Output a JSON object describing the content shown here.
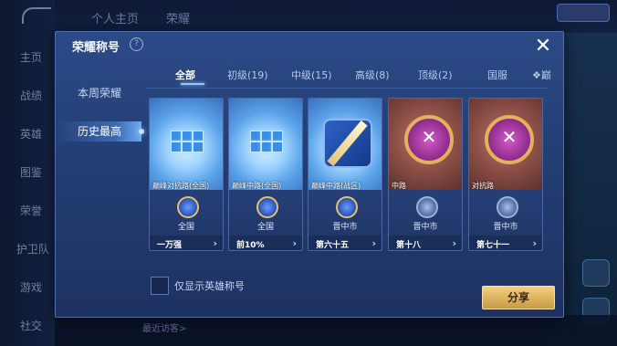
{
  "background": {
    "top_tabs": [
      "个人主页",
      "荣耀"
    ],
    "nav": [
      "主页",
      "战绩",
      "英雄",
      "图鉴",
      "荣誉",
      "护卫队",
      "游戏",
      "社交"
    ],
    "bottom_text": "最近访客>"
  },
  "dialog": {
    "title": "荣耀称号",
    "side_tabs": [
      "本周荣耀",
      "历史最高"
    ],
    "active_side_tab": "历史最高",
    "filter_tabs": [
      "全部",
      "初级(19)",
      "中级(15)",
      "高级(8)",
      "顶级(2)",
      "国服",
      "巅"
    ],
    "active_filter": "全部",
    "cards": [
      {
        "caption": "巅峰对抗路(全国)",
        "region": "全国",
        "rank": "一万强",
        "art": "cube",
        "emblem": "blue"
      },
      {
        "caption": "巅峰中路(全国)",
        "region": "全国",
        "rank": "前10%",
        "art": "cube",
        "emblem": "blue"
      },
      {
        "caption": "巅峰中路(战区)",
        "region": "晋中市",
        "rank": "第六十五",
        "art": "sword",
        "emblem": "blue"
      },
      {
        "caption": "中路",
        "region": "晋中市",
        "rank": "第十八",
        "art": "badge",
        "emblem": "plain"
      },
      {
        "caption": "对抗路",
        "region": "晋中市",
        "rank": "第七十一",
        "art": "badge",
        "emblem": "plain"
      }
    ],
    "checkbox_label": "仅显示英雄称号",
    "share_label": "分享",
    "close_symbol": "✕",
    "help_symbol": "?"
  },
  "colors": {
    "accent": "#8fc7ff",
    "share": "#e3b965",
    "panel": "#2b4a86"
  }
}
